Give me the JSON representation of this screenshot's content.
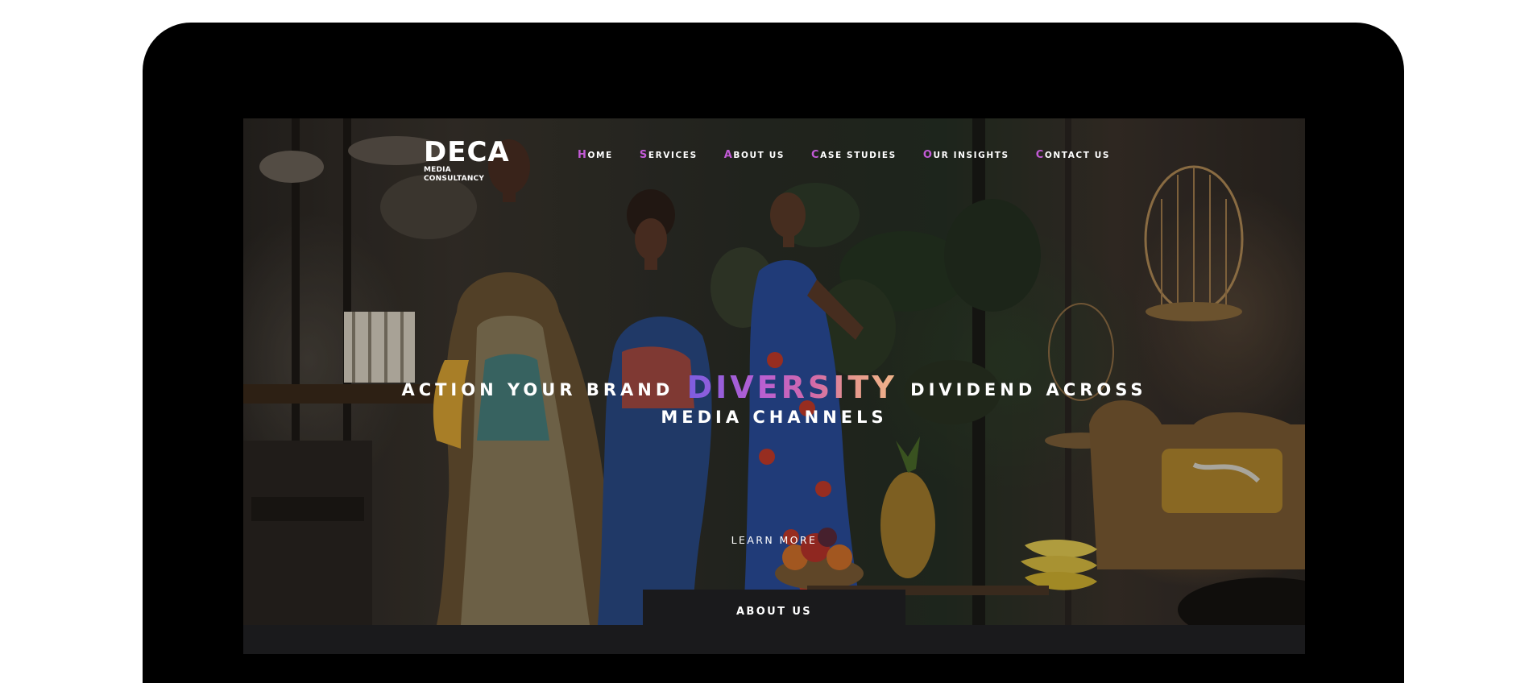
{
  "logo": {
    "word": "DECA",
    "subtitle": "MEDIA CONSULTANCY"
  },
  "nav": [
    {
      "first": "H",
      "rest": "OME"
    },
    {
      "first": "S",
      "rest": "ERVICES"
    },
    {
      "first": "A",
      "rest": "BOUT US"
    },
    {
      "first": "C",
      "rest": "ASE STUDIES"
    },
    {
      "first": "O",
      "rest": "UR INSIGHTS"
    },
    {
      "first": "C",
      "rest": "ONTACT US"
    }
  ],
  "hero": {
    "headline_before": "ACTION YOUR BRAND",
    "headline_highlight": "DIVERSITY",
    "headline_after": "DIVIDEND ACROSS",
    "headline_line2": "MEDIA CHANNELS",
    "cta": "LEARN MORE"
  },
  "about_tab": "ABOUT US",
  "colors": {
    "nav_accent": "#c25ad6",
    "gradient_start": "#7c5de0",
    "gradient_end": "#f0b58a",
    "device_frame": "#000000",
    "footer_bg": "#1a1a1c"
  }
}
